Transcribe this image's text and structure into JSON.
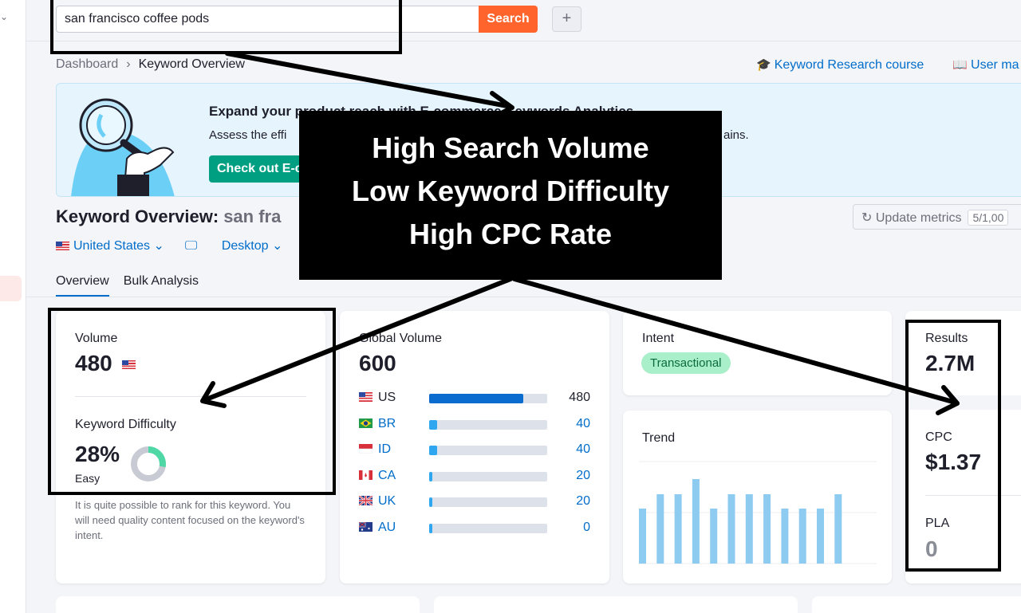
{
  "search": {
    "value": "san francisco coffee pods",
    "button": "Search"
  },
  "breadcrumb": {
    "root": "Dashboard",
    "current": "Keyword Overview"
  },
  "top_links": {
    "course": "Keyword Research course",
    "manual": "User ma"
  },
  "banner": {
    "title": "Expand your product reach with E-commerce Keywords Analytics",
    "text": "Assess the effi",
    "text_end": "ains.",
    "button": "Check out E-c"
  },
  "page": {
    "title": "Keyword Overview:",
    "keyword": "san fra"
  },
  "update": {
    "label": "Update metrics",
    "count": "5/1,00"
  },
  "filters": {
    "country": "United States",
    "device": "Desktop"
  },
  "tabs": [
    {
      "label": "Overview"
    },
    {
      "label": "Bulk Analysis"
    }
  ],
  "volume": {
    "label": "Volume",
    "value": "480"
  },
  "difficulty": {
    "label": "Keyword Difficulty",
    "value": "28%",
    "level": "Easy",
    "percent": 28,
    "desc": "It is quite possible to rank for this keyword. You will need quality content focused on the keyword's intent."
  },
  "global_volume": {
    "label": "Global Volume",
    "value": "600",
    "rows": [
      {
        "code": "US",
        "value": "480",
        "fraction": 0.8
      },
      {
        "code": "BR",
        "value": "40",
        "fraction": 0.07
      },
      {
        "code": "ID",
        "value": "40",
        "fraction": 0.07
      },
      {
        "code": "CA",
        "value": "20",
        "fraction": 0.03
      },
      {
        "code": "UK",
        "value": "20",
        "fraction": 0.03
      },
      {
        "code": "AU",
        "value": "0",
        "fraction": 0.02
      }
    ]
  },
  "intent": {
    "label": "Intent",
    "value": "Transactional"
  },
  "trend": {
    "label": "Trend",
    "values": [
      0.54,
      0.68,
      0.68,
      0.83,
      0.54,
      0.68,
      0.68,
      0.68,
      0.54,
      0.54,
      0.54,
      0.68
    ]
  },
  "results": {
    "label": "Results",
    "value": "2.7M"
  },
  "cpc": {
    "label": "CPC",
    "value": "$1.37"
  },
  "pla": {
    "label": "PLA",
    "value": "0"
  },
  "annotation": {
    "line1": "High Search Volume",
    "line2": "Low Keyword Difficulty",
    "line3": "High CPC Rate"
  },
  "colors": {
    "accent": "#006dca",
    "search_button": "#ff642d",
    "banner_button": "#009f81",
    "trend_bar": "#8ecbf0"
  }
}
